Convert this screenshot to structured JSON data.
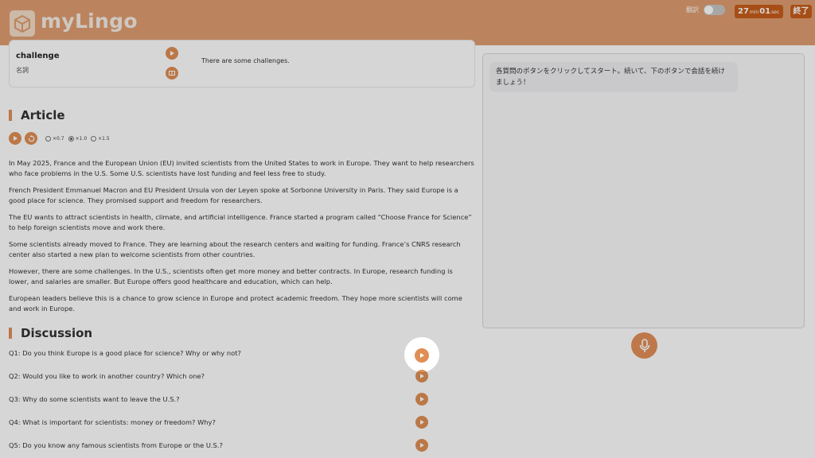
{
  "app": {
    "name": "myLingo"
  },
  "header": {
    "translate_label": "翻訳",
    "timer": {
      "min": "27",
      "min_unit": "min",
      "sec": "01",
      "sec_unit": "sec"
    },
    "end_label": "終了"
  },
  "vocab": {
    "word": "challenge",
    "part_of_speech": "名詞",
    "example": "There are some challenges."
  },
  "article": {
    "heading": "Article",
    "speeds": [
      "×0.7",
      "×1.0",
      "×1.5"
    ],
    "selected_speed": "×1.0",
    "paragraphs": [
      "In May 2025, France and the European Union (EU) invited scientists from the United States to work in Europe. They want to help researchers who face problems in the U.S. Some U.S. scientists have lost funding and feel less free to study.",
      "French President Emmanuel Macron and EU President Ursula von der Leyen spoke at Sorbonne University in Paris. They said Europe is a good place for science. They promised support and freedom for researchers.",
      "The EU wants to attract scientists in health, climate, and artificial intelligence. France started a program called “Choose France for Science” to help foreign scientists move and work there.",
      "Some scientists already moved to France. They are learning about the research centers and waiting for funding. France’s CNRS research center also started a new plan to welcome scientists from other countries.",
      "However, there are some challenges. In the U.S., scientists often get more money and better contracts. In Europe, research funding is lower, and salaries are smaller. But Europe offers good healthcare and education, which can help.",
      "European leaders believe this is a chance to grow science in Europe and protect academic freedom. They hope more scientists will come and work in Europe."
    ]
  },
  "discussion": {
    "heading": "Discussion",
    "questions": [
      "Q1: Do you think Europe is a good place for science? Why or why not?",
      "Q2: Would you like to work in another country? Which one?",
      "Q3: Why do some scientists want to leave the U.S.?",
      "Q4: What is important for scientists: money or freedom? Why?",
      "Q5: Do you know any famous scientists from Europe or the U.S.?"
    ]
  },
  "chat": {
    "messages": [
      {
        "role": "assistant",
        "text": "各質問のボタンをクリックしてスタート。続いて、下のボタンで会話を続けましょう！"
      }
    ]
  },
  "icons": {
    "play": "play-icon",
    "replay": "replay-icon",
    "book": "book-icon",
    "mic": "microphone-icon",
    "logo": "cube-logo-icon"
  },
  "colors": {
    "header": "#df9e70",
    "accent": "#df8f55",
    "dark_accent": "#c85e1b"
  }
}
